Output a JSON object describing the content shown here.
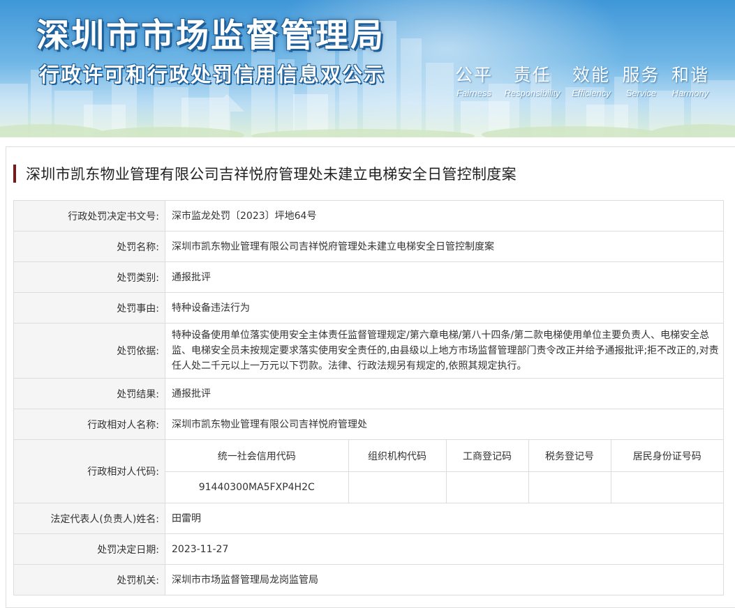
{
  "header": {
    "title": "深圳市市场监督管理局",
    "subtitle": "行政许可和行政处罚信用信息双公示",
    "slogans": [
      {
        "cn": "公平",
        "en": "Fairness"
      },
      {
        "cn": "责任",
        "en": "Responsibility"
      },
      {
        "cn": "效能",
        "en": "Efficiency"
      },
      {
        "cn": "服务",
        "en": "Service"
      },
      {
        "cn": "和谐",
        "en": "Harmony"
      }
    ]
  },
  "case": {
    "title": "深圳市凯东物业管理有限公司吉祥悦府管理处未建立电梯安全日管控制度案",
    "rows": [
      {
        "label": "行政处罚决定书文号:",
        "value": "深市监龙处罚〔2023〕坪地64号"
      },
      {
        "label": "处罚名称:",
        "value": "深圳市凯东物业管理有限公司吉祥悦府管理处未建立电梯安全日管控制度案"
      },
      {
        "label": "处罚类别:",
        "value": "通报批评"
      },
      {
        "label": "处罚事由:",
        "value": "特种设备违法行为"
      },
      {
        "label": "处罚依据:",
        "value": "特种设备使用单位落实使用安全主体责任监督管理规定/第六章电梯/第八十四条/第二款电梯使用单位主要负责人、电梯安全总监、电梯安全员未按规定要求落实使用安全责任的,由县级以上地方市场监督管理部门责令改正并给予通报批评;拒不改正的,对责任人处二千元以上一万元以下罚款。法律、行政法规另有规定的,依照其规定执行。"
      },
      {
        "label": "处罚结果:",
        "value": "通报批评"
      },
      {
        "label": "行政相对人名称:",
        "value": "深圳市凯东物业管理有限公司吉祥悦府管理处"
      }
    ],
    "codes": {
      "label": "行政相对人代码:",
      "headers": [
        "统一社会信用代码",
        "组织机构代码",
        "工商登记码",
        "税务登记号",
        "居民身份证号码"
      ],
      "values": [
        "91440300MA5FXP4H2C",
        "",
        "",
        "",
        ""
      ]
    },
    "rows_after": [
      {
        "label": "法定代表人(负责人)姓名:",
        "value": "田雷明"
      },
      {
        "label": "处罚决定日期:",
        "value": "2023-11-27"
      },
      {
        "label": "处罚机关:",
        "value": "深圳市市场监督管理局龙岗监管局"
      }
    ]
  },
  "colors": {
    "banner_top": "#3f97d8",
    "title_bar": "#7a1a1a",
    "label_bg": "#f5f5f5",
    "border": "#dcdcdc"
  }
}
